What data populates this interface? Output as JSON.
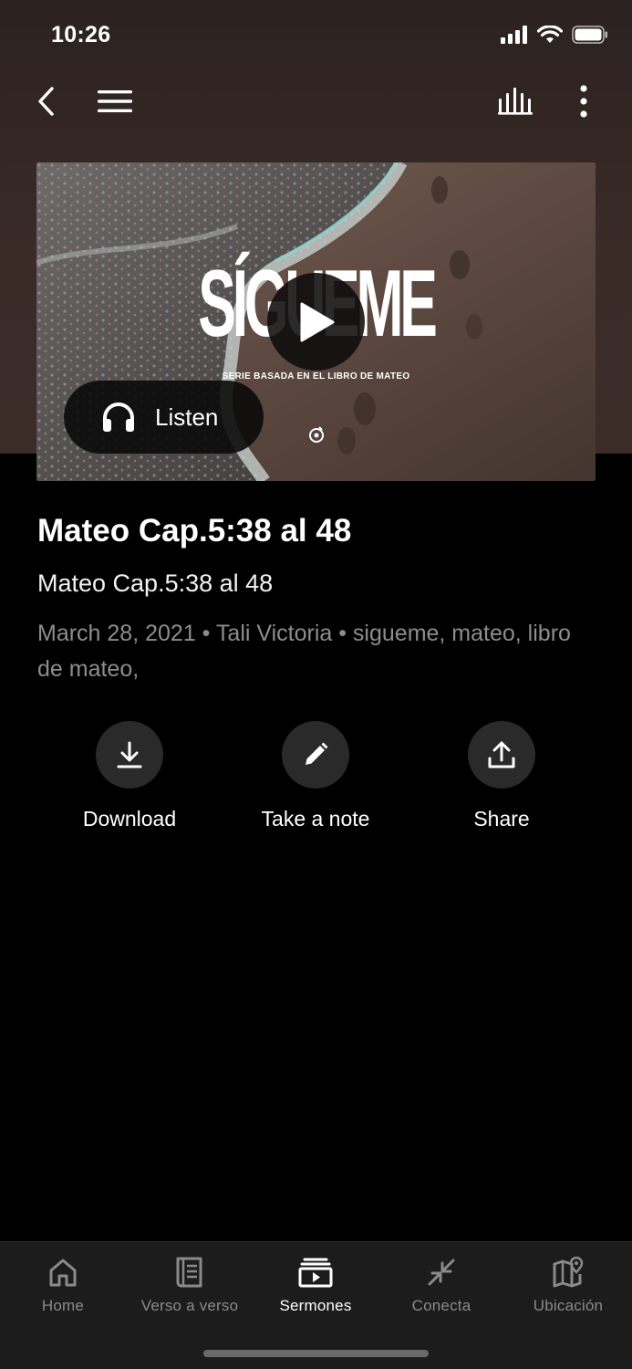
{
  "status_bar": {
    "time": "10:26"
  },
  "nav": {
    "back_icon": "chevron-left-icon",
    "menu_icon": "hamburger-menu-icon",
    "audio_icon": "equalizer-bars-icon",
    "more_icon": "vertical-ellipsis-icon"
  },
  "hero": {
    "artwork_title": "SÍGUEME",
    "artwork_subtitle": "SERIE BASADA EN EL LIBRO DE MATEO",
    "listen_label": "Listen",
    "play_icon": "play-icon",
    "listen_icon": "headphones-icon"
  },
  "sermon": {
    "title": "Mateo Cap.5:38 al 48",
    "subtitle": "Mateo Cap.5:38 al 48",
    "meta": "March 28, 2021 • Tali Victoria • sigueme, mateo, libro de mateo,"
  },
  "actions": [
    {
      "label": "Download",
      "icon": "download-icon"
    },
    {
      "label": "Take a note",
      "icon": "pencil-icon"
    },
    {
      "label": "Share",
      "icon": "share-upload-icon"
    }
  ],
  "tabs": [
    {
      "label": "Home",
      "icon": "home-icon",
      "active": false
    },
    {
      "label": "Verso a verso",
      "icon": "book-icon",
      "active": false
    },
    {
      "label": "Sermones",
      "icon": "video-library-icon",
      "active": true
    },
    {
      "label": "Conecta",
      "icon": "arrows-converge-icon",
      "active": false
    },
    {
      "label": "Ubicación",
      "icon": "map-pin-icon",
      "active": false
    }
  ],
  "colors": {
    "background": "#000000",
    "header_bg": "#3a2b27",
    "tab_bar_bg": "#1c1c1c",
    "muted_text": "#8d8d8d",
    "action_circle": "#2a2a2a"
  }
}
